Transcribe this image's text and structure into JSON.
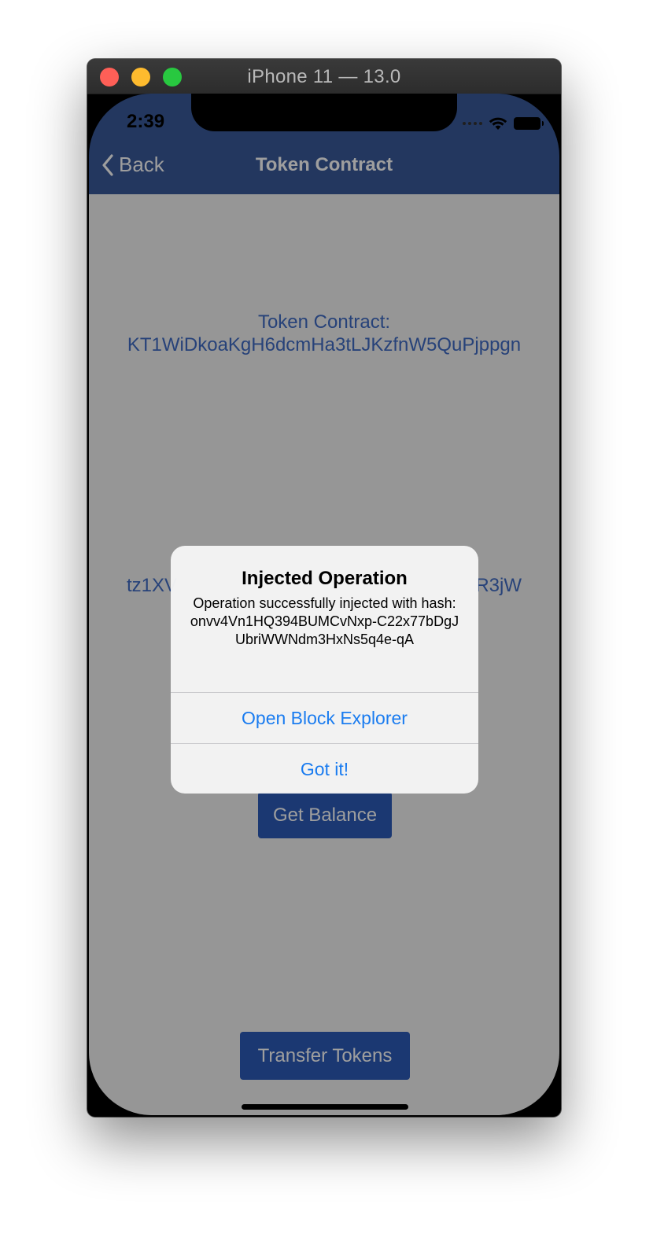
{
  "window": {
    "title": "iPhone 11 — 13.0"
  },
  "status_bar": {
    "time": "2:39"
  },
  "nav": {
    "back_label": "Back",
    "title": "Token Contract"
  },
  "content": {
    "token_contract_label": "Token Contract:",
    "token_contract_address": "KT1WiDkoaKgH6dcmHa3tLJKzfnW5QuPjppgn",
    "account_prefix": "tz1XV",
    "account_suffix": "R3jW",
    "get_balance_label": "Get Balance",
    "transfer_tokens_label": "Transfer Tokens"
  },
  "alert": {
    "title": "Injected Operation",
    "message": "Operation successfully injected with hash: onvv4Vn1HQ394BUMCvNxp-C22x77bDgJUbriWWNdm3HxNs5q4e-qA",
    "primary_button": "Open Block Explorer",
    "secondary_button": "Got it!"
  },
  "colors": {
    "nav_bar": "#39599a",
    "button": "#2c5bb8",
    "link_text": "#3f6bc4",
    "alert_action": "#1a7cf0"
  }
}
